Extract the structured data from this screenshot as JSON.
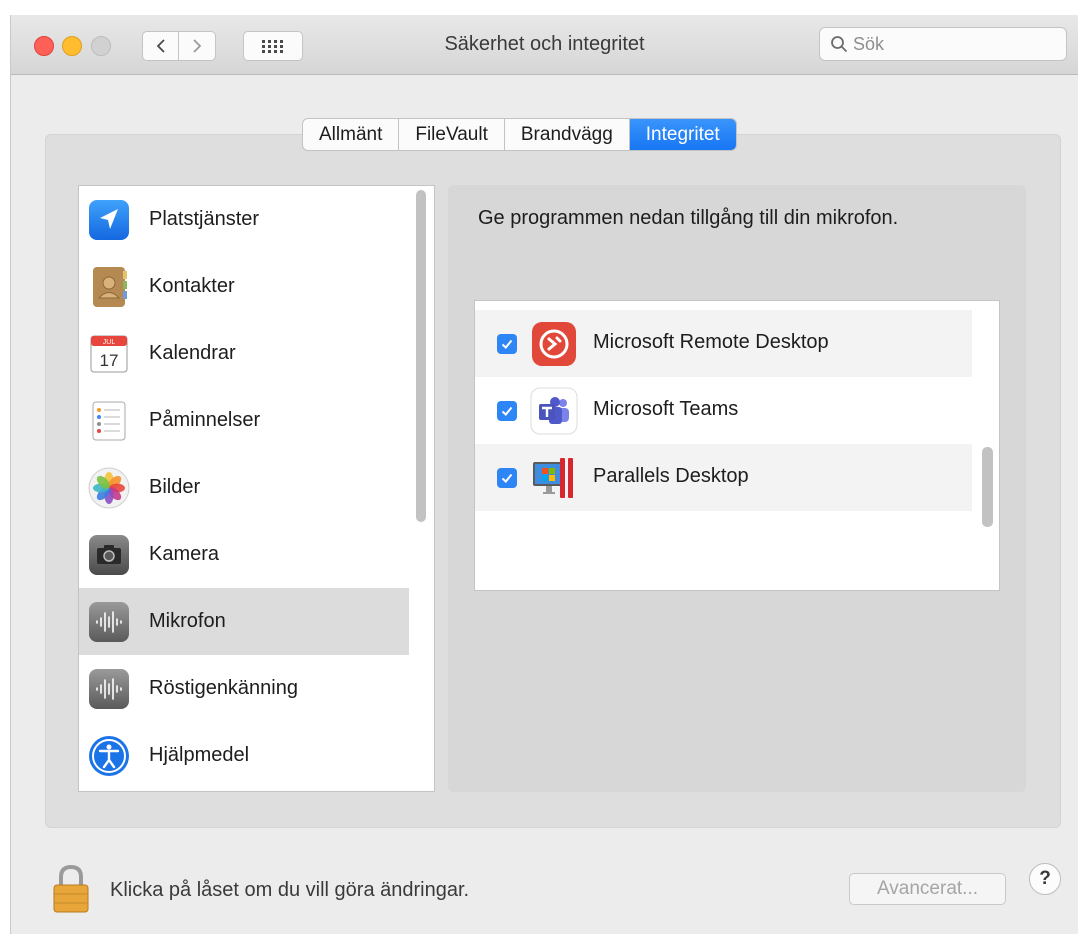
{
  "window": {
    "title": "Säkerhet och integritet"
  },
  "toolbar": {
    "search_placeholder": "Sök"
  },
  "tabs": [
    {
      "label": "Allmänt",
      "active": false
    },
    {
      "label": "FileVault",
      "active": false
    },
    {
      "label": "Brandvägg",
      "active": false
    },
    {
      "label": "Integritet",
      "active": true
    }
  ],
  "sidebar": {
    "items": [
      {
        "label": "Platstjänster",
        "icon": "location-arrow-icon"
      },
      {
        "label": "Kontakter",
        "icon": "contacts-book-icon"
      },
      {
        "label": "Kalendrar",
        "icon": "calendar-icon",
        "icon_month": "JUL",
        "icon_day": "17"
      },
      {
        "label": "Påminnelser",
        "icon": "reminders-icon"
      },
      {
        "label": "Bilder",
        "icon": "photos-icon"
      },
      {
        "label": "Kamera",
        "icon": "camera-icon"
      },
      {
        "label": "Mikrofon",
        "icon": "microphone-waveform-icon",
        "selected": true
      },
      {
        "label": "Röstigenkänning",
        "icon": "speech-waveform-icon"
      },
      {
        "label": "Hjälpmedel",
        "icon": "accessibility-icon"
      }
    ]
  },
  "main": {
    "heading": "Ge programmen nedan tillgång till din mikrofon.",
    "apps": [
      {
        "name": "Microsoft Remote Desktop",
        "checked": true,
        "icon": "remote-desktop-icon"
      },
      {
        "name": "Microsoft Teams",
        "checked": true,
        "icon": "teams-icon"
      },
      {
        "name": "Parallels Desktop",
        "checked": true,
        "icon": "parallels-icon"
      }
    ]
  },
  "footer": {
    "lock_text": "Klicka på låset om du vill göra ändringar.",
    "advanced_label": "Avancerat...",
    "help_label": "?"
  },
  "colors": {
    "accent": "#1a79f5",
    "window_bg": "#ececec",
    "selected_row": "#dcdcdc"
  }
}
